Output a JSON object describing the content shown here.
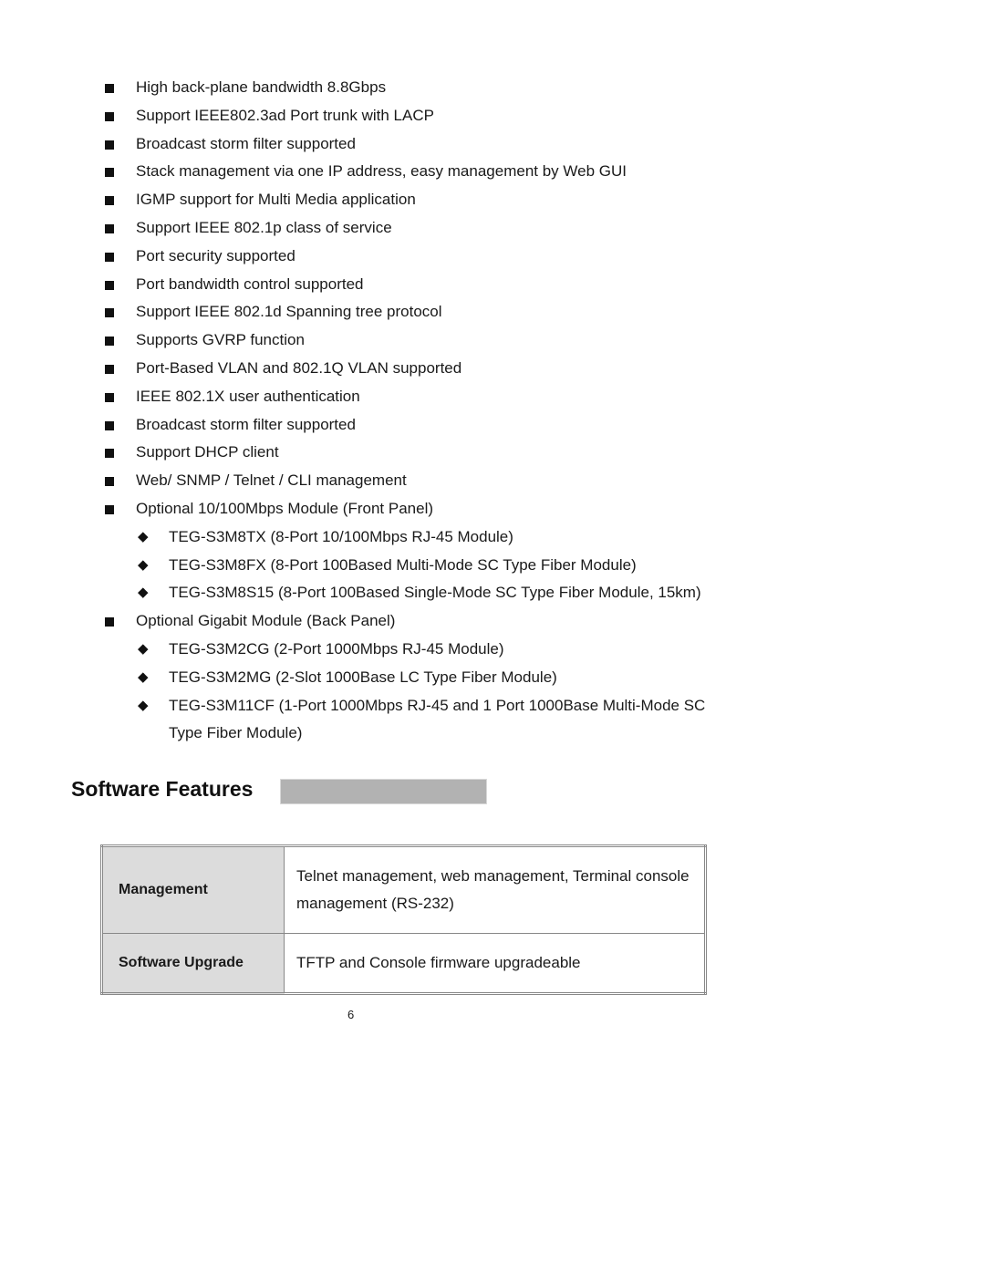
{
  "features": [
    {
      "text": "High back-plane bandwidth 8.8Gbps"
    },
    {
      "text": "Support IEEE802.3ad Port trunk with LACP"
    },
    {
      "text": "Broadcast storm filter supported"
    },
    {
      "text": "Stack management via one IP address, easy management by Web GUI"
    },
    {
      "text": "IGMP support for Multi Media application"
    },
    {
      "text": "Support IEEE 802.1p class of service"
    },
    {
      "text": "Port security supported"
    },
    {
      "text": "Port bandwidth control supported"
    },
    {
      "text": "Support IEEE 802.1d Spanning tree protocol"
    },
    {
      "text": "Supports GVRP function"
    },
    {
      "text": "Port-Based VLAN and 802.1Q VLAN supported"
    },
    {
      "text": "IEEE 802.1X user authentication"
    },
    {
      "text": "Broadcast storm filter supported"
    },
    {
      "text": "Support DHCP client"
    },
    {
      "text": "Web/ SNMP / Telnet / CLI management"
    },
    {
      "text": "Optional 10/100Mbps Module (Front Panel)",
      "sub": [
        "TEG-S3M8TX (8-Port 10/100Mbps RJ-45 Module)",
        "TEG-S3M8FX (8-Port 100Based Multi-Mode SC Type Fiber Module)",
        "TEG-S3M8S15 (8-Port 100Based Single-Mode SC Type Fiber Module, 15km)"
      ]
    },
    {
      "text": "Optional Gigabit Module (Back Panel)",
      "sub": [
        "TEG-S3M2CG (2-Port 1000Mbps RJ-45 Module)",
        "TEG-S3M2MG (2-Slot 1000Base LC Type Fiber Module)",
        "TEG-S3M11CF (1-Port 1000Mbps RJ-45 and 1 Port 1000Base Multi-Mode SC",
        "Type Fiber Module)"
      ]
    }
  ],
  "section": {
    "title": "Software Features"
  },
  "table": {
    "rows": [
      {
        "key": "Management",
        "value": "Telnet management, web management, Terminal console management (RS-232)"
      },
      {
        "key": "Software Upgrade",
        "value": "TFTP and Console firmware upgradeable"
      }
    ]
  },
  "page_number": "6",
  "icons": {
    "bullet": "square-bullet-icon",
    "sub_bullet": "diamond-bullet-icon"
  }
}
